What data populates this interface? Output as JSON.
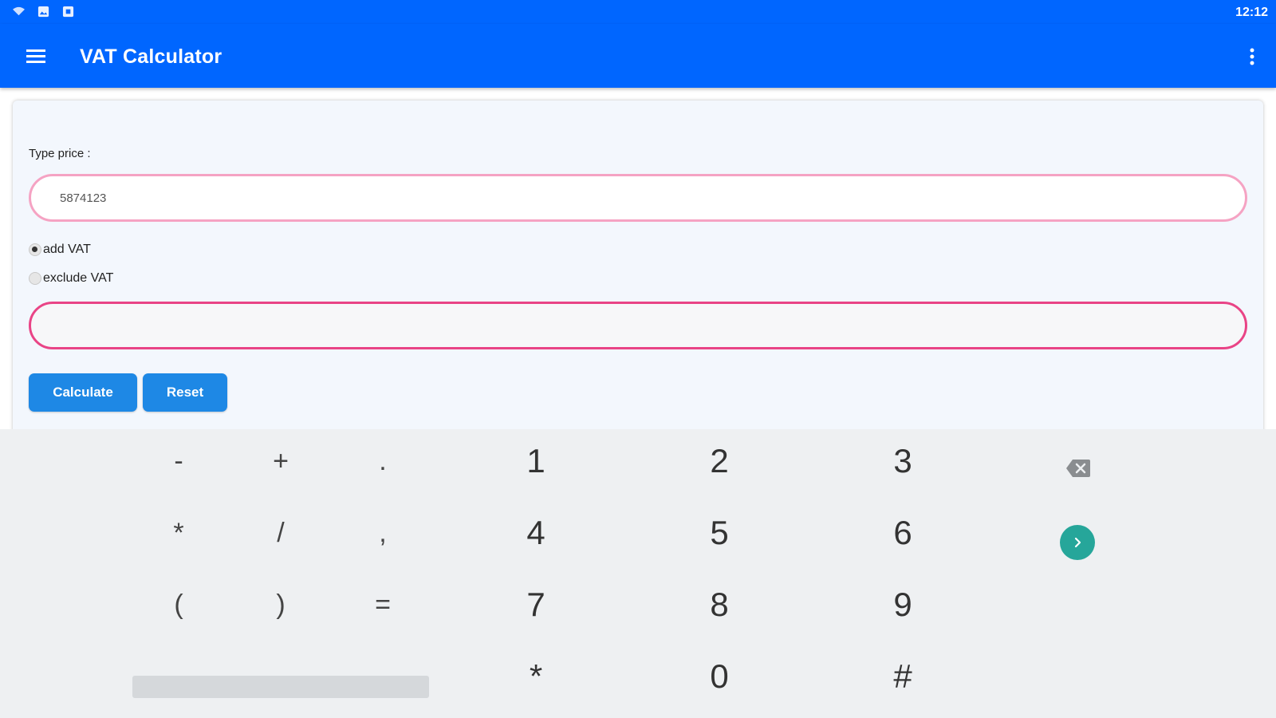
{
  "status_bar": {
    "time": "12:12",
    "icons": [
      "wifi-icon",
      "image-icon",
      "notification-icon"
    ]
  },
  "app_bar": {
    "title": "VAT Calculator",
    "menu_icon": "hamburger-menu-icon",
    "overflow_icon": "more-vert-icon",
    "color": "#0066ff"
  },
  "form": {
    "price_label": "Type price :",
    "price_value": "5874123",
    "vat_options": [
      {
        "label": "add VAT",
        "checked": true
      },
      {
        "label": "exclude VAT",
        "checked": false
      }
    ],
    "result_value": "",
    "calculate_label": "Calculate",
    "reset_label": "Reset",
    "button_color": "#1e88e5",
    "input_border_color": "#f5a3c3",
    "result_border_color": "#e94486"
  },
  "keyboard": {
    "rows": [
      [
        "-",
        "+",
        ".",
        "1",
        "2",
        "3"
      ],
      [
        "*",
        "/",
        ",",
        "4",
        "5",
        "6"
      ],
      [
        "(",
        ")",
        "=",
        "7",
        "8",
        "9"
      ],
      [
        "*",
        "0",
        "#"
      ]
    ],
    "backspace_icon": "backspace-icon",
    "go_icon": "chevron-right-icon",
    "go_color": "#26a69a"
  }
}
